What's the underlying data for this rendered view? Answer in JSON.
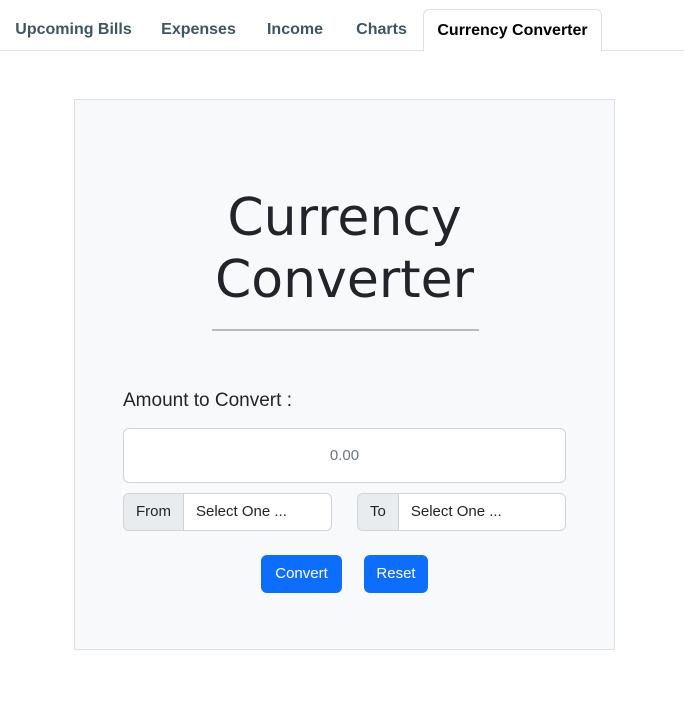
{
  "tabs": [
    {
      "label": "Upcoming Bills"
    },
    {
      "label": "Expenses"
    },
    {
      "label": "Income"
    },
    {
      "label": "Charts"
    },
    {
      "label": "Currency Converter",
      "active": true
    }
  ],
  "converter": {
    "title_line1": "Currency",
    "title_line2": "Converter",
    "amount_label": "Amount to Convert :",
    "amount_placeholder": "0.00",
    "from_label": "From",
    "from_selected": "Select One ...",
    "to_label": "To",
    "to_selected": "Select One ...",
    "convert_label": "Convert",
    "reset_label": "Reset"
  },
  "colors": {
    "accent": "#0d6efd",
    "card_background": "#f8f9fa",
    "tab_text": "#3f5560"
  }
}
